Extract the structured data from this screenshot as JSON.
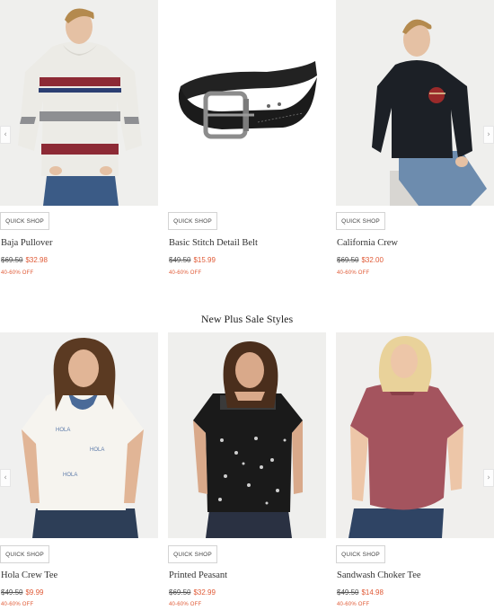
{
  "row1": {
    "products": [
      {
        "name": "Baja Pullover",
        "orig": "$69.50",
        "sale": "$32.98",
        "discount": "40-60% OFF",
        "quick_shop": "QUICK SHOP"
      },
      {
        "name": "Basic Stitch Detail Belt",
        "orig": "$49.50",
        "sale": "$15.99",
        "discount": "40-60% OFF",
        "quick_shop": "QUICK SHOP"
      },
      {
        "name": "California Crew",
        "orig": "$69.50",
        "sale": "$32.00",
        "discount": "40-60% OFF",
        "quick_shop": "QUICK SHOP"
      }
    ]
  },
  "section": {
    "title": "New Plus Sale Styles"
  },
  "row2": {
    "products": [
      {
        "name": "Hola Crew Tee",
        "orig": "$49.50",
        "sale": "$9.99",
        "discount": "40-60% OFF",
        "quick_shop": "QUICK SHOP"
      },
      {
        "name": "Printed Peasant",
        "orig": "$69.50",
        "sale": "$32.99",
        "discount": "40-60% OFF",
        "quick_shop": "QUICK SHOP"
      },
      {
        "name": "Sandwash Choker Tee",
        "orig": "$49.50",
        "sale": "$14.98",
        "discount": "40-60% OFF",
        "quick_shop": "QUICK SHOP"
      }
    ]
  },
  "icons": {
    "prev": "chevron-left-icon",
    "next": "chevron-right-icon"
  },
  "colors": {
    "sale": "#e05a36",
    "photo_bg": "#f3f3f3"
  }
}
